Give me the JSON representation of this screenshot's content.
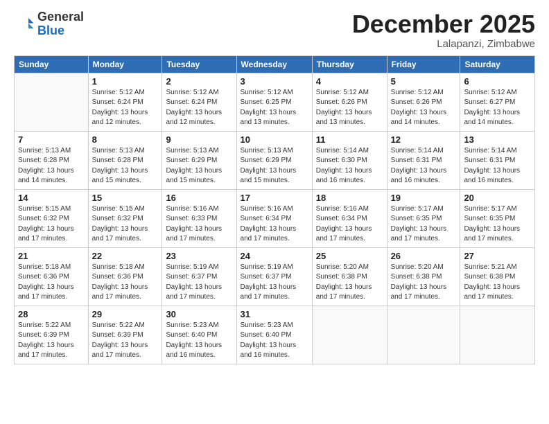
{
  "header": {
    "logo_general": "General",
    "logo_blue": "Blue",
    "month_title": "December 2025",
    "location": "Lalapanzi, Zimbabwe"
  },
  "days_of_week": [
    "Sunday",
    "Monday",
    "Tuesday",
    "Wednesday",
    "Thursday",
    "Friday",
    "Saturday"
  ],
  "weeks": [
    [
      {
        "day": "",
        "info": ""
      },
      {
        "day": "1",
        "info": "Sunrise: 5:12 AM\nSunset: 6:24 PM\nDaylight: 13 hours\nand 12 minutes."
      },
      {
        "day": "2",
        "info": "Sunrise: 5:12 AM\nSunset: 6:24 PM\nDaylight: 13 hours\nand 12 minutes."
      },
      {
        "day": "3",
        "info": "Sunrise: 5:12 AM\nSunset: 6:25 PM\nDaylight: 13 hours\nand 13 minutes."
      },
      {
        "day": "4",
        "info": "Sunrise: 5:12 AM\nSunset: 6:26 PM\nDaylight: 13 hours\nand 13 minutes."
      },
      {
        "day": "5",
        "info": "Sunrise: 5:12 AM\nSunset: 6:26 PM\nDaylight: 13 hours\nand 14 minutes."
      },
      {
        "day": "6",
        "info": "Sunrise: 5:12 AM\nSunset: 6:27 PM\nDaylight: 13 hours\nand 14 minutes."
      }
    ],
    [
      {
        "day": "7",
        "info": "Sunrise: 5:13 AM\nSunset: 6:28 PM\nDaylight: 13 hours\nand 14 minutes."
      },
      {
        "day": "8",
        "info": "Sunrise: 5:13 AM\nSunset: 6:28 PM\nDaylight: 13 hours\nand 15 minutes."
      },
      {
        "day": "9",
        "info": "Sunrise: 5:13 AM\nSunset: 6:29 PM\nDaylight: 13 hours\nand 15 minutes."
      },
      {
        "day": "10",
        "info": "Sunrise: 5:13 AM\nSunset: 6:29 PM\nDaylight: 13 hours\nand 15 minutes."
      },
      {
        "day": "11",
        "info": "Sunrise: 5:14 AM\nSunset: 6:30 PM\nDaylight: 13 hours\nand 16 minutes."
      },
      {
        "day": "12",
        "info": "Sunrise: 5:14 AM\nSunset: 6:31 PM\nDaylight: 13 hours\nand 16 minutes."
      },
      {
        "day": "13",
        "info": "Sunrise: 5:14 AM\nSunset: 6:31 PM\nDaylight: 13 hours\nand 16 minutes."
      }
    ],
    [
      {
        "day": "14",
        "info": "Sunrise: 5:15 AM\nSunset: 6:32 PM\nDaylight: 13 hours\nand 17 minutes."
      },
      {
        "day": "15",
        "info": "Sunrise: 5:15 AM\nSunset: 6:32 PM\nDaylight: 13 hours\nand 17 minutes."
      },
      {
        "day": "16",
        "info": "Sunrise: 5:16 AM\nSunset: 6:33 PM\nDaylight: 13 hours\nand 17 minutes."
      },
      {
        "day": "17",
        "info": "Sunrise: 5:16 AM\nSunset: 6:34 PM\nDaylight: 13 hours\nand 17 minutes."
      },
      {
        "day": "18",
        "info": "Sunrise: 5:16 AM\nSunset: 6:34 PM\nDaylight: 13 hours\nand 17 minutes."
      },
      {
        "day": "19",
        "info": "Sunrise: 5:17 AM\nSunset: 6:35 PM\nDaylight: 13 hours\nand 17 minutes."
      },
      {
        "day": "20",
        "info": "Sunrise: 5:17 AM\nSunset: 6:35 PM\nDaylight: 13 hours\nand 17 minutes."
      }
    ],
    [
      {
        "day": "21",
        "info": "Sunrise: 5:18 AM\nSunset: 6:36 PM\nDaylight: 13 hours\nand 17 minutes."
      },
      {
        "day": "22",
        "info": "Sunrise: 5:18 AM\nSunset: 6:36 PM\nDaylight: 13 hours\nand 17 minutes."
      },
      {
        "day": "23",
        "info": "Sunrise: 5:19 AM\nSunset: 6:37 PM\nDaylight: 13 hours\nand 17 minutes."
      },
      {
        "day": "24",
        "info": "Sunrise: 5:19 AM\nSunset: 6:37 PM\nDaylight: 13 hours\nand 17 minutes."
      },
      {
        "day": "25",
        "info": "Sunrise: 5:20 AM\nSunset: 6:38 PM\nDaylight: 13 hours\nand 17 minutes."
      },
      {
        "day": "26",
        "info": "Sunrise: 5:20 AM\nSunset: 6:38 PM\nDaylight: 13 hours\nand 17 minutes."
      },
      {
        "day": "27",
        "info": "Sunrise: 5:21 AM\nSunset: 6:38 PM\nDaylight: 13 hours\nand 17 minutes."
      }
    ],
    [
      {
        "day": "28",
        "info": "Sunrise: 5:22 AM\nSunset: 6:39 PM\nDaylight: 13 hours\nand 17 minutes."
      },
      {
        "day": "29",
        "info": "Sunrise: 5:22 AM\nSunset: 6:39 PM\nDaylight: 13 hours\nand 17 minutes."
      },
      {
        "day": "30",
        "info": "Sunrise: 5:23 AM\nSunset: 6:40 PM\nDaylight: 13 hours\nand 16 minutes."
      },
      {
        "day": "31",
        "info": "Sunrise: 5:23 AM\nSunset: 6:40 PM\nDaylight: 13 hours\nand 16 minutes."
      },
      {
        "day": "",
        "info": ""
      },
      {
        "day": "",
        "info": ""
      },
      {
        "day": "",
        "info": ""
      }
    ]
  ]
}
